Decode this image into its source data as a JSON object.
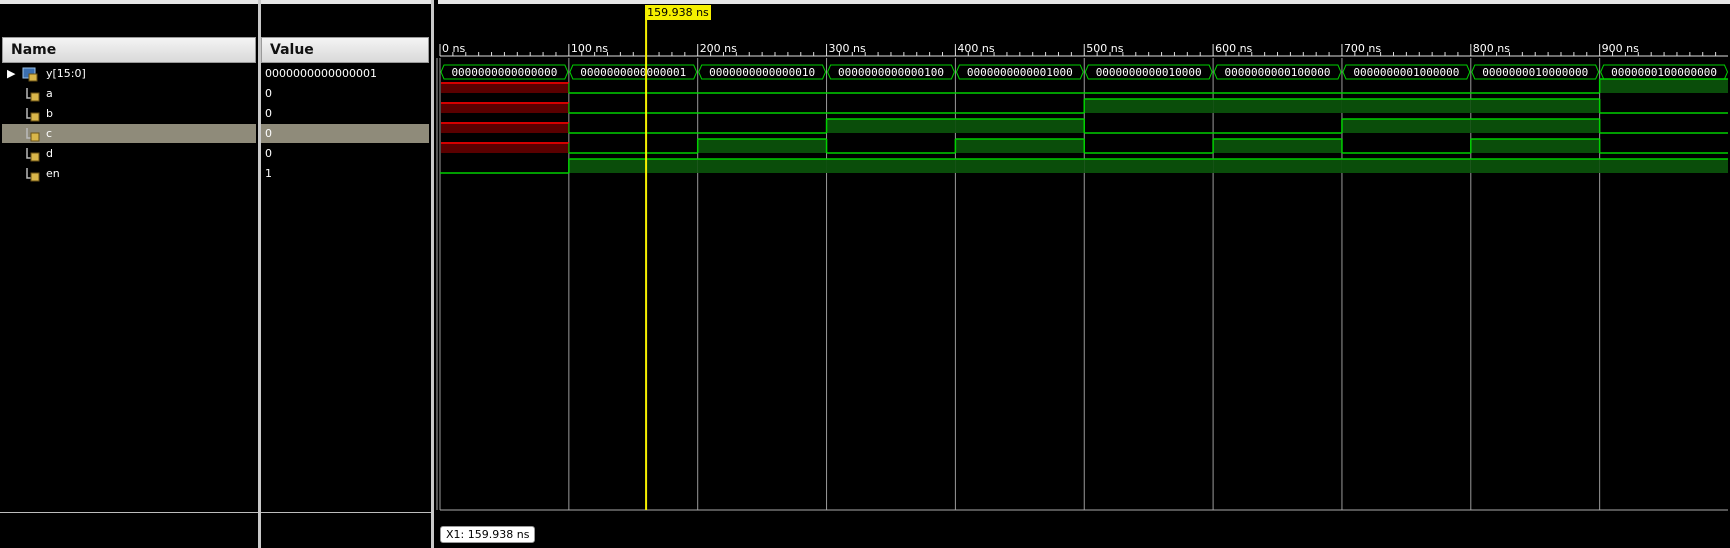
{
  "names_header": "Name",
  "values_header": "Value",
  "cursor_label": "159.938 ns",
  "readout_label": "X1: 159.938 ns",
  "signals": [
    {
      "name": "y[15:0]",
      "value": "0000000000000001",
      "kind": "bus",
      "icon": "bus-icon",
      "selected": false
    },
    {
      "name": "a",
      "value": "0",
      "kind": "bit",
      "icon": "signal-icon",
      "selected": false
    },
    {
      "name": "b",
      "value": "0",
      "kind": "bit",
      "icon": "signal-icon",
      "selected": false
    },
    {
      "name": "c",
      "value": "0",
      "kind": "bit",
      "icon": "signal-icon",
      "selected": true
    },
    {
      "name": "d",
      "value": "0",
      "kind": "bit",
      "icon": "signal-icon",
      "selected": false
    },
    {
      "name": "en",
      "value": "1",
      "kind": "bit",
      "icon": "signal-icon",
      "selected": false
    }
  ],
  "timeline": {
    "ticks": [
      "0 ns",
      "100 ns",
      "200 ns",
      "300 ns",
      "400 ns",
      "500 ns",
      "600 ns",
      "700 ns",
      "800 ns",
      "900 ns"
    ],
    "cursor_ns": 159.938
  },
  "bus_values": [
    "0000000000000000",
    "0000000000000001",
    "0000000000000010",
    "0000000000000100",
    "0000000000001000",
    "0000000000010000",
    "0000000000100000",
    "0000000001000000",
    "0000000010000000",
    "0000000100000000"
  ],
  "bit_waves": {
    "a": [
      "X",
      "0",
      "0",
      "0",
      "0",
      "0",
      "0",
      "0",
      "0",
      "1"
    ],
    "b": [
      "X",
      "0",
      "0",
      "0",
      "0",
      "1",
      "1",
      "1",
      "1",
      "0"
    ],
    "c": [
      "X",
      "0",
      "0",
      "1",
      "1",
      "0",
      "0",
      "1",
      "1",
      "0"
    ],
    "d": [
      "X",
      "0",
      "1",
      "0",
      "1",
      "0",
      "1",
      "0",
      "1",
      "0"
    ],
    "en": [
      "0",
      "1",
      "1",
      "1",
      "1",
      "1",
      "1",
      "1",
      "1",
      "1"
    ]
  },
  "colors": {
    "wave": "#00d000",
    "wave_fill": "#0a4d0a",
    "x_state": "#d40000",
    "cursor": "#f5ef00",
    "grid": "#9a9a9a"
  }
}
